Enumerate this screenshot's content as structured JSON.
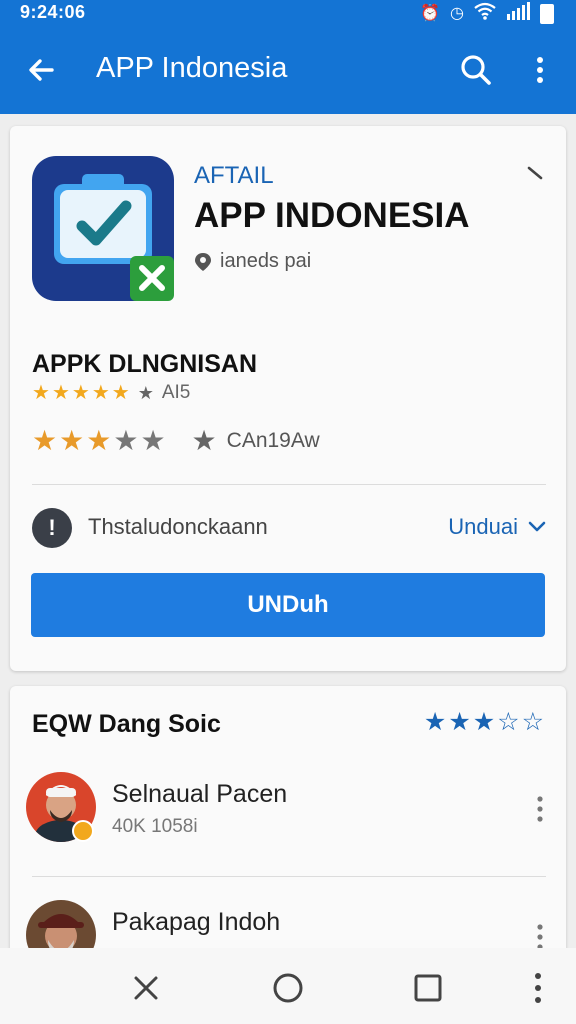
{
  "status_bar": {
    "time": "9:24:06",
    "icons": [
      "alarm-icon",
      "clock-icon",
      "wifi-icon",
      "signal-icon",
      "battery-icon"
    ]
  },
  "app_bar": {
    "title": "APP Indonesia",
    "icons": [
      "back-arrow-icon",
      "search-icon",
      "more-vert-icon"
    ]
  },
  "app": {
    "category": "AFTAIL",
    "name": "APP INDONESIA",
    "developer": "ianeds pai",
    "icon": "checkbox-clipboard-icon"
  },
  "rating": {
    "title": "APPK DLNGNISAN",
    "score_text": "AI5",
    "score_stars": 5,
    "count_text": "CAn19Aw",
    "count_stars": 3
  },
  "info": {
    "text": "Thstaludonckaann",
    "link": "Unduai"
  },
  "install_button": {
    "label": "UNDuh"
  },
  "reviews_section": {
    "title": "EQW Dang Soic",
    "stars": 3,
    "reviews": [
      {
        "name": "Selnaual Pacen",
        "meta": "40K 1058i"
      },
      {
        "name": "Pakapag Indoh",
        "meta": ""
      }
    ]
  },
  "colors": {
    "primary": "#1474d4",
    "button": "#1f7ce0",
    "star_gold": "#f2a81d",
    "star_blue": "#1a64b4",
    "link": "#1a64b4"
  },
  "nav_bar": {
    "icons": [
      "close-icon",
      "home-circle-icon",
      "recents-square-icon",
      "more-vert-icon"
    ]
  }
}
